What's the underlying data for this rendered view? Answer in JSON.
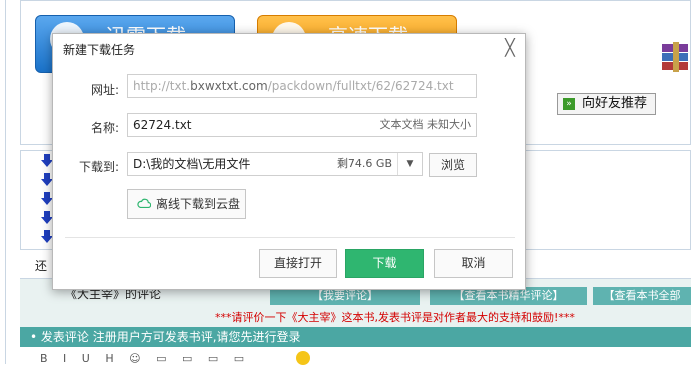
{
  "background": {
    "btn_xunlei": "迅雷下载",
    "btn_gaosu": "高速下载",
    "recommend": "向好友推荐",
    "recommend_icon": "»",
    "huan": "还",
    "review_title": "《大主宰》的评论",
    "teal_buttons": [
      "【我要评论】",
      "【查看本书精华评论】",
      "【查看本书全部"
    ],
    "notice": "***请评价一下《大主宰》这本书,发表书评是对作者最大的支持和鼓励!***",
    "green_bar": "• 发表评论  注册用户方可发表书评,请您先进行登录",
    "toolbar_glyphs": "B I U H ☺ ▭ ▭ ▭ ▭"
  },
  "dialog": {
    "title": "新建下载任务",
    "close_glyph": "╳",
    "url_label": "网址:",
    "url_prefix": "http://txt.",
    "url_host": "bxwxtxt.com",
    "url_path": "/packdown/fulltxt/62/62724.txt",
    "name_label": "名称:",
    "name_value": "62724.txt",
    "name_meta": "文本文档 未知大小",
    "save_label": "下载到:",
    "save_path": "D:\\我的文档\\无用文件",
    "free_space": "剩74.6 GB",
    "dropdown_glyph": "▼",
    "browse": "浏览",
    "cloud_btn": "离线下载到云盘",
    "open_btn": "直接打开",
    "download_btn": "下载",
    "cancel_btn": "取消"
  },
  "colors": {
    "download_green": "#2fb670",
    "xunlei_blue": "#1a72c9",
    "gaosu_orange": "#f08f00",
    "teal": "#4ba7a3",
    "notice_red": "#d40000"
  }
}
